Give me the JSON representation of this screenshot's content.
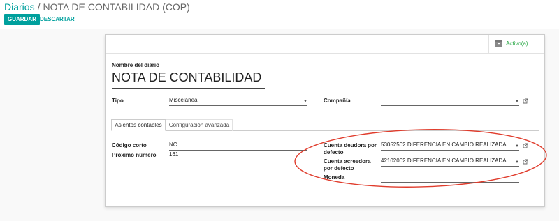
{
  "breadcrumb": {
    "parent": "Diarios",
    "separator": "/",
    "current": "NOTA DE CONTABILIDAD (COP)"
  },
  "toolbar": {
    "save_label": "GUARDAR",
    "discard_label": "DESCARTAR"
  },
  "stat_button": {
    "label": "Activo(a)",
    "icon": "archive-icon"
  },
  "form": {
    "name_label": "Nombre del diario",
    "name_value": "NOTA DE CONTABILIDAD",
    "tipo_label": "Tipo",
    "tipo_value": "Miscelánea",
    "company_label": "Compañía",
    "company_value": ""
  },
  "tabs": [
    {
      "label": "Asientos contables",
      "active": true
    },
    {
      "label": "Configuración avanzada",
      "active": false
    }
  ],
  "tab_content": {
    "short_code_label": "Código corto",
    "short_code_value": "NC",
    "next_number_label": "Próximo número",
    "next_number_value": "161",
    "debit_account_label": "Cuenta deudora por defecto",
    "debit_account_value": "53052502 DIFERENCIA EN CAMBIO REALIZADA",
    "credit_account_label": "Cuenta acreedora por defecto",
    "credit_account_value": "42102002 DIFERENCIA EN CAMBIO REALIZADA",
    "currency_label": "Moneda",
    "currency_value": ""
  },
  "colors": {
    "brand": "#00a09d",
    "active_status": "#28a745",
    "annotation": "#e03c2c"
  },
  "annotation": "red-ellipse-highlight"
}
